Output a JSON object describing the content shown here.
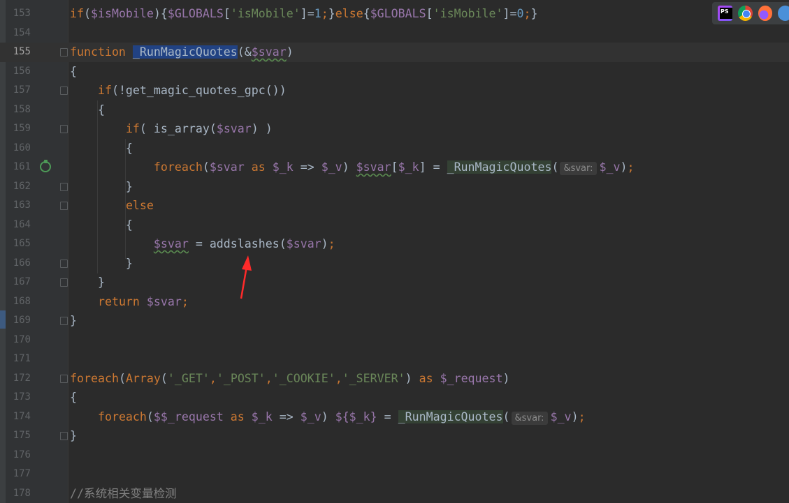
{
  "editor": {
    "current_line": 155,
    "lines": [
      {
        "n": "153",
        "t": [
          [
            "kw",
            "if"
          ],
          [
            "",
            "("
          ],
          [
            "var",
            "$isMobile"
          ],
          [
            "",
            "){"
          ],
          [
            "var",
            "$GLOBALS"
          ],
          [
            "",
            "["
          ],
          [
            "str",
            "'isMobile'"
          ],
          [
            "",
            "]="
          ],
          [
            "num",
            "1"
          ],
          [
            "kw",
            ";"
          ],
          [
            "",
            "}"
          ],
          [
            "kw",
            "else"
          ],
          [
            "",
            "{"
          ],
          [
            "var",
            "$GLOBALS"
          ],
          [
            "",
            "["
          ],
          [
            "str",
            "'isMobile'"
          ],
          [
            "",
            "]="
          ],
          [
            "num",
            "0"
          ],
          [
            "kw",
            ";"
          ],
          [
            "",
            "}"
          ]
        ]
      },
      {
        "n": "154",
        "t": []
      },
      {
        "n": "155",
        "t": [
          [
            "kw",
            "function "
          ],
          [
            "sel",
            "_RunMagicQuotes"
          ],
          [
            "",
            "(&"
          ],
          [
            "var wav",
            "$svar"
          ],
          [
            "",
            ")"
          ]
        ],
        "fold": "start"
      },
      {
        "n": "156",
        "t": [
          [
            "",
            "{"
          ]
        ]
      },
      {
        "n": "157",
        "t": [
          [
            "",
            "    "
          ],
          [
            "kw",
            "if"
          ],
          [
            "",
            "(!get_magic_quotes_gpc())"
          ]
        ],
        "fold": "start"
      },
      {
        "n": "158",
        "t": [
          [
            "",
            "    {"
          ]
        ]
      },
      {
        "n": "159",
        "t": [
          [
            "",
            "        "
          ],
          [
            "kw",
            "if"
          ],
          [
            "",
            "( is_array("
          ],
          [
            "var",
            "$svar"
          ],
          [
            "",
            ") )"
          ]
        ],
        "fold": "start"
      },
      {
        "n": "160",
        "t": [
          [
            "",
            "        {"
          ]
        ]
      },
      {
        "n": "161",
        "t": [
          [
            "",
            "            "
          ],
          [
            "kw",
            "foreach"
          ],
          [
            "",
            "("
          ],
          [
            "var",
            "$svar"
          ],
          [
            "kw",
            " as "
          ],
          [
            "var",
            "$_k"
          ],
          [
            "",
            ""
          ],
          [
            "",
            " => "
          ],
          [
            "var",
            "$_v"
          ],
          [
            "",
            ") "
          ],
          [
            "var wav",
            "$svar"
          ],
          [
            "",
            "["
          ],
          [
            "var",
            "$_k"
          ],
          [
            "",
            "] = "
          ],
          [
            "fnhl",
            "_RunMagicQuotes"
          ],
          [
            "",
            "("
          ],
          [
            "hint",
            "&svar:"
          ],
          [
            "var",
            "$_v"
          ],
          [
            "",
            ")"
          ],
          [
            "kw",
            ";"
          ]
        ],
        "run": true
      },
      {
        "n": "162",
        "t": [
          [
            "",
            "        }"
          ]
        ],
        "fold": "end"
      },
      {
        "n": "163",
        "t": [
          [
            "",
            "        "
          ],
          [
            "kw",
            "else"
          ]
        ],
        "fold": "start"
      },
      {
        "n": "164",
        "t": [
          [
            "",
            "        {"
          ]
        ]
      },
      {
        "n": "165",
        "t": [
          [
            "",
            "            "
          ],
          [
            "var wav",
            "$svar"
          ],
          [
            "",
            " = addslashes("
          ],
          [
            "var",
            "$svar"
          ],
          [
            "",
            ")"
          ],
          [
            "kw",
            ";"
          ]
        ]
      },
      {
        "n": "166",
        "t": [
          [
            "",
            "        }"
          ]
        ],
        "fold": "end"
      },
      {
        "n": "167",
        "t": [
          [
            "",
            "    }"
          ]
        ],
        "fold": "end"
      },
      {
        "n": "168",
        "t": [
          [
            "",
            "    "
          ],
          [
            "kw",
            "return "
          ],
          [
            "var",
            "$svar"
          ],
          [
            "kw",
            ";"
          ]
        ]
      },
      {
        "n": "169",
        "t": [
          [
            "",
            "}"
          ]
        ],
        "fold": "end"
      },
      {
        "n": "170",
        "t": []
      },
      {
        "n": "171",
        "t": []
      },
      {
        "n": "172",
        "t": [
          [
            "kw",
            "foreach"
          ],
          [
            "",
            "("
          ],
          [
            "kw",
            "Array"
          ],
          [
            "",
            "("
          ],
          [
            "str",
            "'_GET'"
          ],
          [
            "kw",
            ","
          ],
          [
            "str",
            "'_POST'"
          ],
          [
            "kw",
            ","
          ],
          [
            "str",
            "'_COOKIE'"
          ],
          [
            "kw",
            ","
          ],
          [
            "str",
            "'_SERVER'"
          ],
          [
            "",
            ") "
          ],
          [
            "kw",
            "as "
          ],
          [
            "var",
            "$_request"
          ],
          [
            "",
            ")"
          ]
        ],
        "fold": "start"
      },
      {
        "n": "173",
        "t": [
          [
            "",
            "{"
          ]
        ]
      },
      {
        "n": "174",
        "t": [
          [
            "",
            "    "
          ],
          [
            "kw",
            "foreach"
          ],
          [
            "",
            "("
          ],
          [
            "var",
            "$$_request"
          ],
          [
            "kw",
            " as "
          ],
          [
            "var",
            "$_k"
          ],
          [
            "",
            " => "
          ],
          [
            "var",
            "$_v"
          ],
          [
            "",
            ") "
          ],
          [
            "var",
            "${$_k}"
          ],
          [
            "",
            " = "
          ],
          [
            "fnhl",
            "_RunMagicQuotes"
          ],
          [
            "",
            "("
          ],
          [
            "hint",
            "&svar:"
          ],
          [
            "var",
            "$_v"
          ],
          [
            "",
            ")"
          ],
          [
            "kw",
            ";"
          ]
        ]
      },
      {
        "n": "175",
        "t": [
          [
            "",
            "}"
          ]
        ],
        "fold": "end"
      },
      {
        "n": "176",
        "t": []
      },
      {
        "n": "177",
        "t": []
      },
      {
        "n": "178",
        "t": [
          [
            "cm",
            "//系统相关变量检测"
          ]
        ]
      }
    ]
  },
  "toolbar": {
    "icons": [
      "phpstorm-icon",
      "chrome-icon",
      "firefox-icon",
      "browser-icon"
    ]
  },
  "colors": {
    "background": "#2b2b2b",
    "keyword": "#cc7832",
    "variable": "#9876aa",
    "string": "#6a8759",
    "number": "#6897bb",
    "annotation_arrow": "#ff2a2a"
  }
}
